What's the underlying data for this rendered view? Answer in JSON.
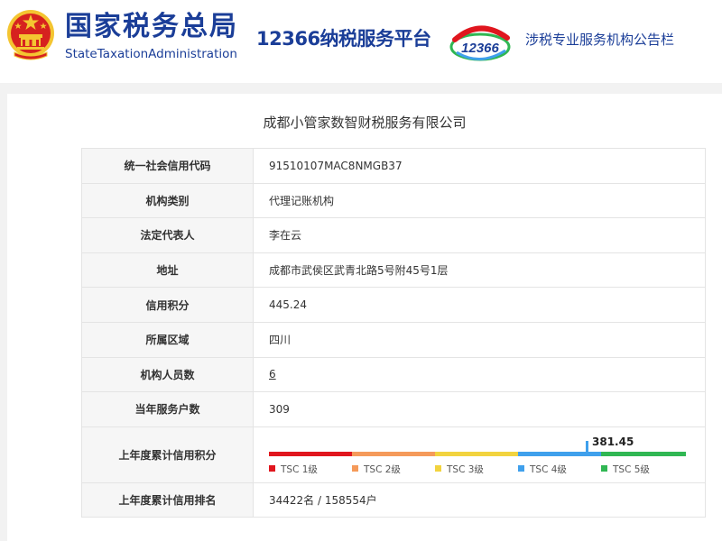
{
  "header": {
    "brand_cn": "国家税务总局",
    "brand_en": "StateTaxationAdministration",
    "platform": "12366纳税服务平台",
    "logo_number": "12366",
    "bulletin": "涉税专业服务机构公告栏"
  },
  "company": {
    "name": "成都小管家数智财税服务有限公司"
  },
  "rows": [
    {
      "label": "统一社会信用代码",
      "value": "91510107MAC8NMGB37"
    },
    {
      "label": "机构类别",
      "value": "代理记账机构"
    },
    {
      "label": "法定代表人",
      "value": "李在云"
    },
    {
      "label": "地址",
      "value": "成都市武侯区武青北路5号附45号1层"
    },
    {
      "label": "信用积分",
      "value": "445.24"
    },
    {
      "label": "所属区域",
      "value": "四川"
    },
    {
      "label": "机构人员数",
      "value": "6"
    },
    {
      "label": "当年服务户数",
      "value": "309"
    }
  ],
  "credit_last_year": {
    "label": "上年度累计信用积分",
    "score": "381.45",
    "score_value": 381.45,
    "scale_max": 500,
    "levels": [
      {
        "name": "TSC 1级",
        "color": "#e0161e"
      },
      {
        "name": "TSC 2级",
        "color": "#f59a5a"
      },
      {
        "name": "TSC 3级",
        "color": "#f2d33e"
      },
      {
        "name": "TSC 4级",
        "color": "#3fa0ec"
      },
      {
        "name": "TSC 5级",
        "color": "#30b753"
      }
    ]
  },
  "rank_last_year": {
    "label": "上年度累计信用排名",
    "value": "34422名 / 158554户"
  },
  "colors": {
    "brand_blue": "#1b3e98",
    "emblem_red": "#d6221f",
    "emblem_gold": "#f4c531"
  }
}
